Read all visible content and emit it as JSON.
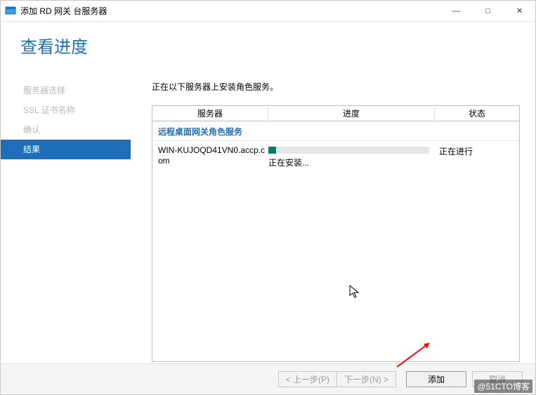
{
  "window": {
    "title": "添加 RD 网关 台服务器",
    "controls": {
      "minimize": "—",
      "maximize": "□",
      "close": "✕"
    }
  },
  "header": {
    "page_title": "查看进度"
  },
  "sidebar": {
    "items": [
      {
        "label": "服务器选择",
        "active": false
      },
      {
        "label": "SSL 证书名称",
        "active": false
      },
      {
        "label": "确认",
        "active": false
      },
      {
        "label": "结果",
        "active": true
      }
    ]
  },
  "main": {
    "instruction": "正在以下服务器上安装角色服务。",
    "columns": {
      "server": "服务器",
      "progress": "进度",
      "status": "状态"
    },
    "group_title": "远程桌面网关角色服务",
    "rows": [
      {
        "server": "WIN-KUJOQD41VN0.accp.com",
        "progress_percent": 5,
        "progress_text": "正在安装...",
        "status": "正在进行"
      }
    ]
  },
  "footer": {
    "prev": "< 上一步(P)",
    "next": "下一步(N) >",
    "add": "添加",
    "cancel": "取消"
  },
  "watermark": "@51CTO博客"
}
